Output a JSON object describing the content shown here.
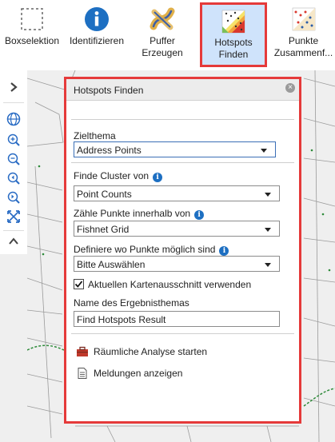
{
  "toolbar": {
    "items": [
      {
        "label_1": "Boxselektion",
        "label_2": "",
        "icon": "box-select-icon"
      },
      {
        "label_1": "Identifizieren",
        "label_2": "",
        "icon": "info-icon"
      },
      {
        "label_1": "Puffer",
        "label_2": "Erzeugen",
        "icon": "buffer-icon"
      },
      {
        "label_1": "Hotspots",
        "label_2": "Finden",
        "icon": "hotspot-icon"
      },
      {
        "label_1": "Punkte",
        "label_2": "Zusammenf...",
        "icon": "aggregate-points-icon"
      }
    ]
  },
  "panel": {
    "title": "Hotspots Finden",
    "zielthema_label": "Zielthema",
    "zielthema_value": "Address Points",
    "cluster_label": "Finde Cluster von",
    "cluster_value": "Point Counts",
    "count_label": "Zähle Punkte innerhalb von",
    "count_value": "Fishnet Grid",
    "where_label": "Definiere wo Punkte möglich sind",
    "where_value": "Bitte Auswählen",
    "extent_label": "Aktuellen Kartenausschnitt verwenden",
    "extent_checked": true,
    "result_label": "Name des Ergebnisthemas",
    "result_value": "Find Hotspots Result",
    "start_label": "Räumliche Analyse starten",
    "messages_label": "Meldungen anzeigen"
  },
  "colors": {
    "highlight_border": "#e53a3a",
    "active_tool_bg": "#cfe3fb",
    "info_blue": "#1d6fc2"
  }
}
